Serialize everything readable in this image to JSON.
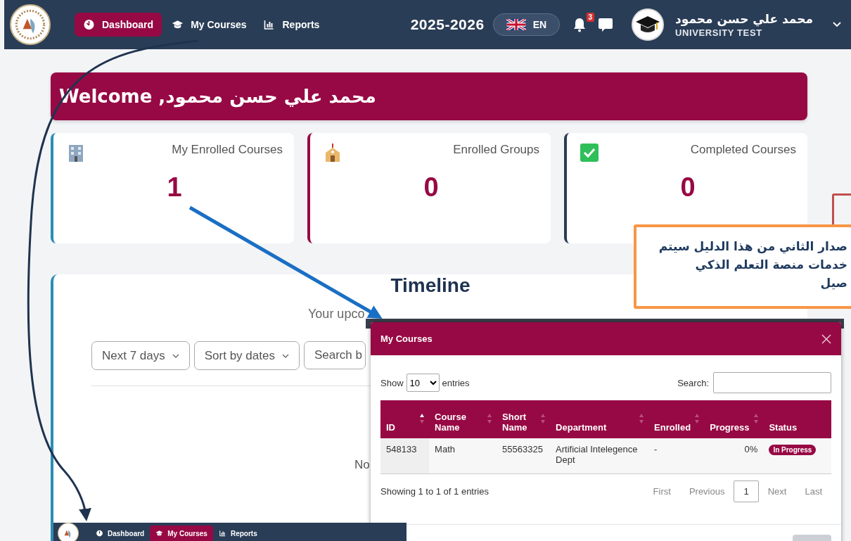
{
  "navbar": {
    "nav_items": [
      {
        "label": "Dashboard",
        "selected": true
      },
      {
        "label": "My Courses",
        "selected": false
      },
      {
        "label": "Reports",
        "selected": false
      }
    ],
    "academic_year": "2025-2026",
    "language": "EN",
    "notifications": "3",
    "user": {
      "name": "محمد علي حسن محمود",
      "org": "UNIVERSITY TEST"
    }
  },
  "welcome": "Welcome ,محمد علي حسن محمود",
  "stats": [
    {
      "label": "My Enrolled Courses",
      "value": "1",
      "color": "#2a8db5"
    },
    {
      "label": "Enrolled Groups",
      "value": "0",
      "color": "#970944"
    },
    {
      "label": "Completed Courses",
      "value": "0",
      "color": "#2a3d56"
    }
  ],
  "timeline": {
    "title": "Timeline",
    "subtitle": "Your upco",
    "filters": [
      "Next 7 days",
      "Sort by dates"
    ],
    "search_placeholder": "Search b",
    "empty_text": "No"
  },
  "callout": {
    "lines": [
      "صدار الثاني من هذا الدليل سيتم",
      "خدمات منصة التعلم الذكي",
      "صيل"
    ]
  },
  "modal": {
    "title": "My Courses",
    "show_label": "Show",
    "page_size": "10",
    "entries_label": "entries",
    "search_label": "Search:",
    "columns": [
      {
        "label": "ID",
        "sortable": true,
        "sorted": true
      },
      {
        "label": "Course Name",
        "sortable": true,
        "sorted": false
      },
      {
        "label": "Short Name",
        "sortable": true,
        "sorted": false
      },
      {
        "label": "Department",
        "sortable": true,
        "sorted": false
      },
      {
        "label": "Enrolled",
        "sortable": true,
        "sorted": false
      },
      {
        "label": "Progress",
        "sortable": true,
        "sorted": false
      },
      {
        "label": "Status",
        "sortable": false,
        "sorted": false
      }
    ],
    "rows": [
      {
        "cells": [
          "548133",
          "Math",
          "55563325",
          "Artificial Intelegence Dept",
          "-",
          "0%"
        ],
        "status": "In Progress"
      }
    ],
    "info": "Showing 1 to 1 of 1 entries",
    "pagination": [
      {
        "label": "First",
        "selected": false
      },
      {
        "label": "Previous",
        "selected": false
      },
      {
        "label": "1",
        "selected": true
      },
      {
        "label": "Next",
        "selected": false
      },
      {
        "label": "Last",
        "selected": false
      }
    ]
  },
  "inset_navbar": {
    "nav_items": [
      {
        "label": "Dashboard",
        "selected": false
      },
      {
        "label": "My Courses",
        "selected": true
      },
      {
        "label": "Reports",
        "selected": false
      }
    ]
  }
}
